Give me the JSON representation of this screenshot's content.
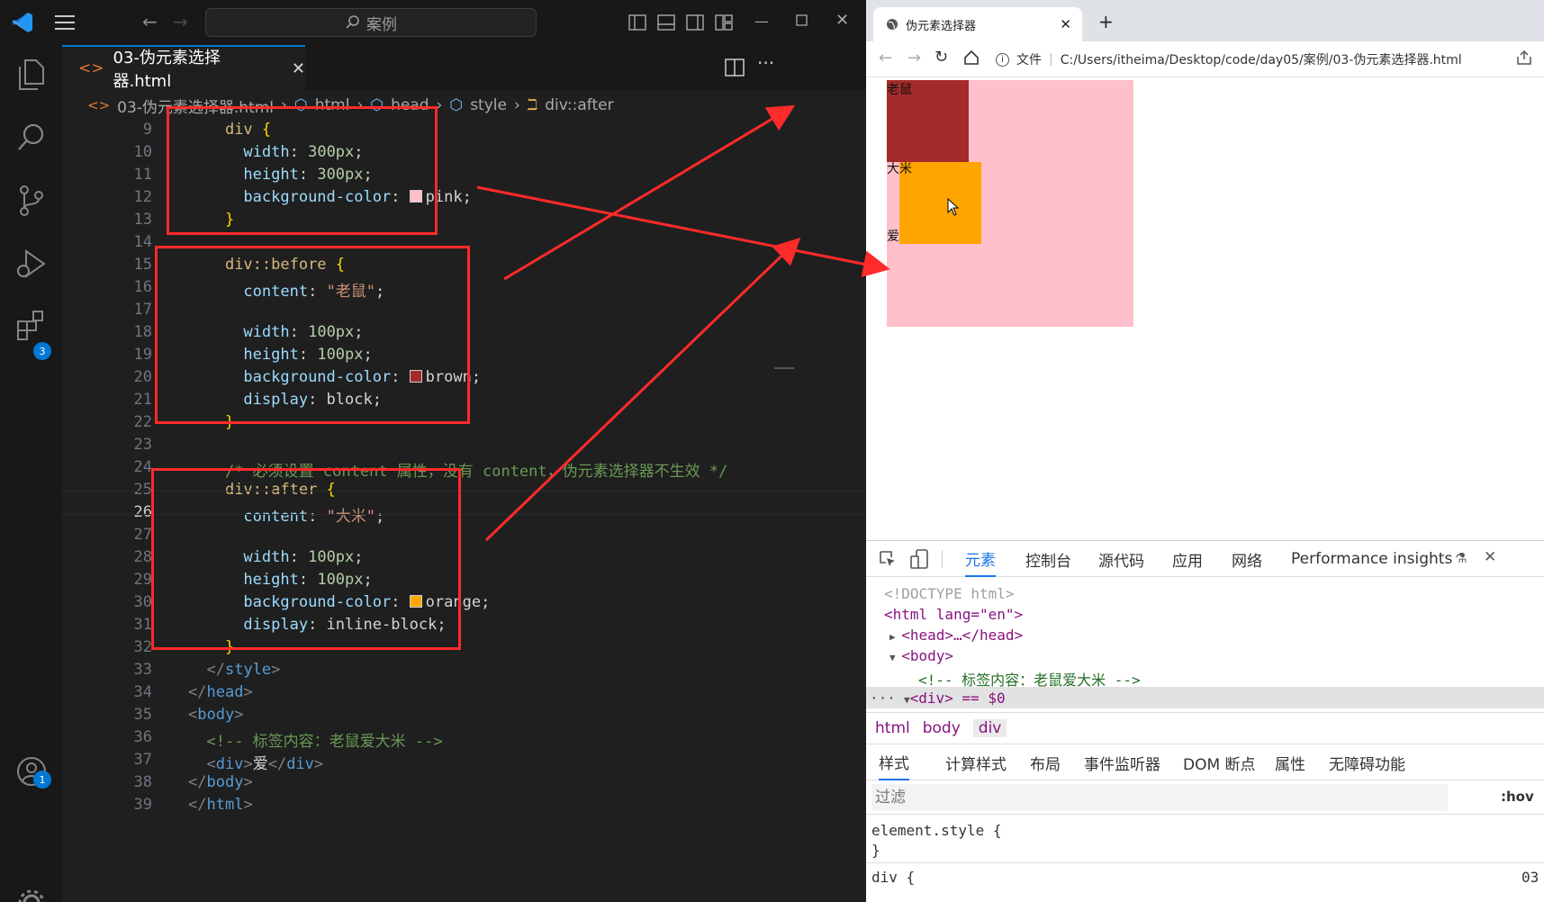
{
  "vscode": {
    "search_label": "案例",
    "tab_label": "03-伪元素选择器.html",
    "breadcrumb": [
      "03-伪元素选择器.html",
      "html",
      "head",
      "style",
      "div::after"
    ],
    "extensions_badge": "3",
    "account_badge": "1",
    "lines": [
      {
        "n": "9",
        "t": "    div {"
      },
      {
        "n": "10",
        "t": "      width: 300px;"
      },
      {
        "n": "11",
        "t": "      height: 300px;"
      },
      {
        "n": "12",
        "t": "      background-color: pink;"
      },
      {
        "n": "13",
        "t": "    }"
      },
      {
        "n": "14",
        "t": ""
      },
      {
        "n": "15",
        "t": "    div::before {"
      },
      {
        "n": "16",
        "t": "      content: \"老鼠\";"
      },
      {
        "n": "17",
        "t": ""
      },
      {
        "n": "18",
        "t": "      width: 100px;"
      },
      {
        "n": "19",
        "t": "      height: 100px;"
      },
      {
        "n": "20",
        "t": "      background-color: brown;"
      },
      {
        "n": "21",
        "t": "      display: block;"
      },
      {
        "n": "22",
        "t": "    }"
      },
      {
        "n": "23",
        "t": ""
      },
      {
        "n": "24",
        "t": "    /* 必须设置 content 属性，没有 content，伪元素选择器不生效 */"
      },
      {
        "n": "25",
        "t": "    div::after {"
      },
      {
        "n": "26",
        "t": "      content: \"大米\";"
      },
      {
        "n": "27",
        "t": ""
      },
      {
        "n": "28",
        "t": "      width: 100px;"
      },
      {
        "n": "29",
        "t": "      height: 100px;"
      },
      {
        "n": "30",
        "t": "      background-color: orange;"
      },
      {
        "n": "31",
        "t": "      display: inline-block;"
      },
      {
        "n": "32",
        "t": "    }"
      },
      {
        "n": "33",
        "t": "  </style>"
      },
      {
        "n": "34",
        "t": "</head>"
      },
      {
        "n": "35",
        "t": "<body>"
      },
      {
        "n": "36",
        "t": "  <!-- 标签内容：老鼠爱大米 -->"
      },
      {
        "n": "37",
        "t": "  <div>爱</div>"
      },
      {
        "n": "38",
        "t": "</body>"
      },
      {
        "n": "39",
        "t": "</html>"
      }
    ]
  },
  "browser": {
    "tab_title": "伪元素选择器",
    "address_prefix": "文件",
    "url": "C:/Users/itheima/Desktop/code/day05/案例/03-伪元素选择器.html",
    "page": {
      "before_text": "老鼠",
      "main_text": "爱",
      "after_text": "大米"
    },
    "devtools": {
      "tabs": [
        "元素",
        "控制台",
        "源代码",
        "应用",
        "网络",
        "Performance insights"
      ],
      "dom": [
        "<!DOCTYPE html>",
        "<html lang=\"en\">",
        "<head>…</head>",
        "<body>",
        "<!-- 标签内容：老鼠爱大米 -->",
        "<div> == $0"
      ],
      "path": [
        "html",
        "body",
        "div"
      ],
      "style_tabs": [
        "样式",
        "计算样式",
        "布局",
        "事件监听器",
        "DOM 断点",
        "属性",
        "无障碍功能"
      ],
      "filter_placeholder": "过滤",
      "hov": ":hov",
      "element_style": "element.style {",
      "close_brace": "}",
      "div_rule": "div {",
      "rule_source": "03"
    }
  },
  "colors": {
    "pink": "#ffc0cb",
    "brown": "#a52a2a",
    "orange": "#ffa500",
    "annotation": "#ff2a2a"
  }
}
